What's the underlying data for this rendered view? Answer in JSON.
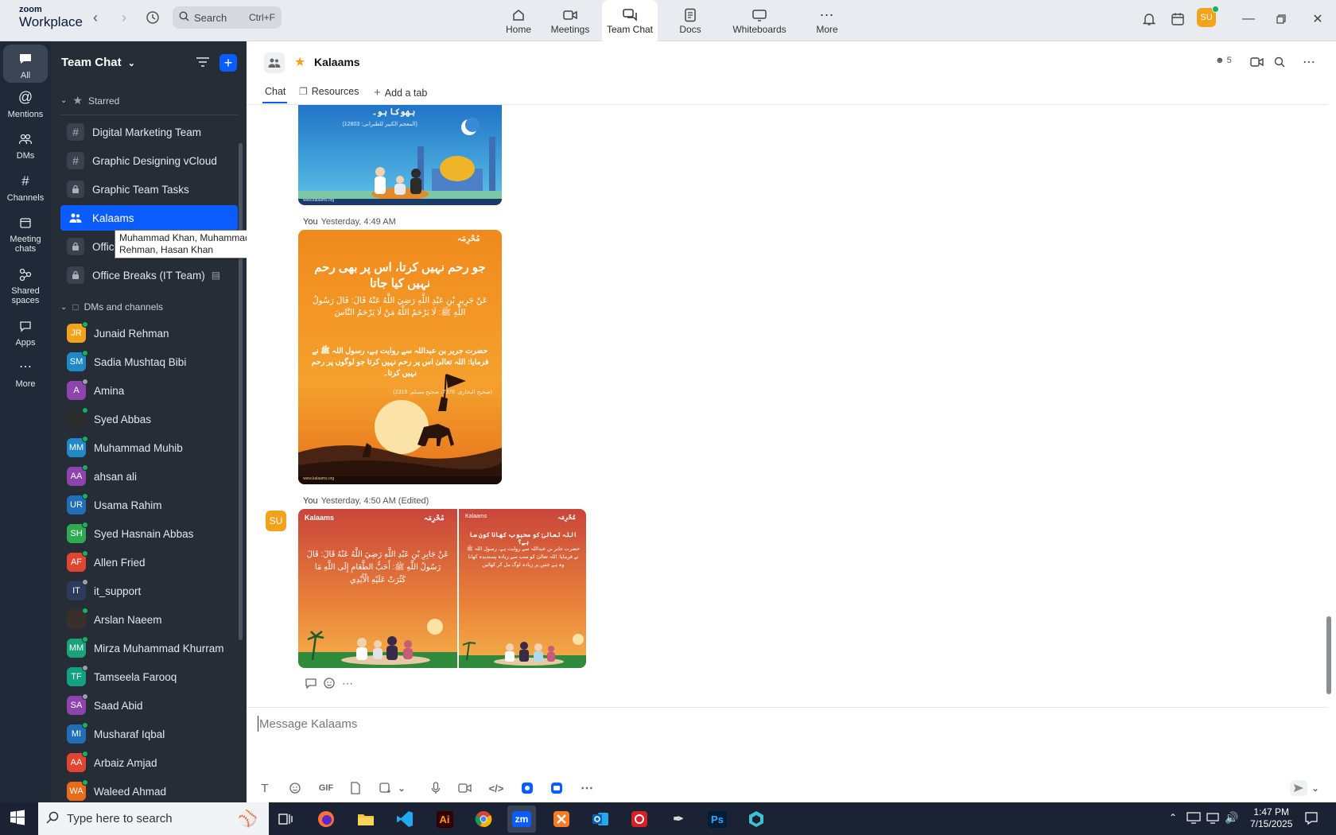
{
  "app": {
    "logo_line1": "zoom",
    "logo_line2": "Workplace"
  },
  "search": {
    "placeholder": "Search",
    "shortcut": "Ctrl+F"
  },
  "top_tabs": [
    {
      "label": "Home",
      "icon": "home-icon"
    },
    {
      "label": "Meetings",
      "icon": "video-camera-icon"
    },
    {
      "label": "Team Chat",
      "icon": "chat-bubbles-icon",
      "active": true
    },
    {
      "label": "Docs",
      "icon": "document-icon"
    },
    {
      "label": "Whiteboards",
      "icon": "whiteboard-icon"
    },
    {
      "label": "More",
      "icon": "more-icon"
    }
  ],
  "user": {
    "initials": "SU",
    "status": "online"
  },
  "rail": [
    {
      "label": "All",
      "icon": "chat-icon",
      "active": true
    },
    {
      "label": "Mentions",
      "icon": "at-icon"
    },
    {
      "label": "DMs",
      "icon": "people-icon"
    },
    {
      "label": "Channels",
      "icon": "hash-icon"
    },
    {
      "label": "Meeting chats",
      "icon": "calendar-icon"
    },
    {
      "label": "Shared spaces",
      "icon": "shared-spaces-icon"
    },
    {
      "label": "Apps",
      "icon": "apps-icon"
    },
    {
      "label": "More",
      "icon": "more-icon"
    }
  ],
  "sidebar": {
    "title": "Team Chat",
    "starred_label": "Starred",
    "starred": [
      {
        "name": "Digital Marketing Team",
        "icon": "hash-icon"
      },
      {
        "name": "Graphic Designing vCloud",
        "icon": "hash-icon"
      },
      {
        "name": "Graphic Team Tasks",
        "icon": "lock-icon"
      },
      {
        "name": "Kalaams",
        "icon": "people-icon",
        "active": true
      },
      {
        "name": "Offic",
        "icon": "lock-icon"
      },
      {
        "name": "Office Breaks (IT Team)",
        "icon": "lock-icon"
      }
    ],
    "dms_label": "DMs and channels",
    "dms": [
      {
        "name": "Junaid Rehman",
        "initials": "JR",
        "color": "#f2a21b",
        "status": "#12b35a"
      },
      {
        "name": "Sadia Mushtaq Bibi",
        "initials": "SM",
        "color": "#1e88c8",
        "status": "#12b35a"
      },
      {
        "name": "Amina",
        "initials": "A",
        "color": "#8e44ad",
        "status": "#9aa0a6"
      },
      {
        "name": "Syed Abbas",
        "initials": "",
        "color": "#2b2b2b",
        "status": "#12b35a"
      },
      {
        "name": "Muhammad Muhib",
        "initials": "MM",
        "color": "#1e88c8",
        "status": "#12b35a"
      },
      {
        "name": "ahsan ali",
        "initials": "AA",
        "color": "#8e44ad",
        "status": "#12b35a"
      },
      {
        "name": "Usama Rahim",
        "initials": "UR",
        "color": "#1e6fb8",
        "status": "#12b35a"
      },
      {
        "name": "Syed Hasnain Abbas",
        "initials": "SH",
        "color": "#2eaa52",
        "status": "#12b35a"
      },
      {
        "name": "Allen Fried",
        "initials": "AF",
        "color": "#e0452f",
        "status": "#12b35a"
      },
      {
        "name": "it_support",
        "initials": "IT",
        "color": "#2d3a5c",
        "status": "#9aa0a6"
      },
      {
        "name": "Arslan Naeem",
        "initials": "",
        "color": "#3a2f2a",
        "status": "#12b35a"
      },
      {
        "name": "Mirza Muhammad Khurram",
        "initials": "MM",
        "color": "#1aa37a",
        "status": "#12b35a"
      },
      {
        "name": "Tamseela Farooq",
        "initials": "TF",
        "color": "#14a085",
        "status": "#9aa0a6"
      },
      {
        "name": "Saad Abid",
        "initials": "SA",
        "color": "#8e44ad",
        "status": "#9aa0a6"
      },
      {
        "name": "Musharaf Iqbal",
        "initials": "MI",
        "color": "#1e6fb8",
        "status": "#12b35a"
      },
      {
        "name": "Arbaiz Amjad",
        "initials": "AA",
        "color": "#e0452f",
        "status": "#12b35a"
      },
      {
        "name": "Waleed Ahmad",
        "initials": "WA",
        "color": "#e86a1a",
        "status": "#12b35a"
      }
    ],
    "tooltip": "Muhammad Khan, Muhammad Muhib, Junaid Rehman, Hasan Khan"
  },
  "channel": {
    "title": "Kalaams",
    "member_count": "5",
    "tabs": [
      {
        "label": "Chat",
        "active": true
      },
      {
        "label": "Resources"
      },
      {
        "label": "Add a tab"
      }
    ]
  },
  "messages": [
    {
      "sender": "You",
      "time": "Yesterday, 4:49 AM"
    },
    {
      "sender": "You",
      "time": "Yesterday, 4:50 AM (Edited)",
      "avatar": "SU"
    }
  ],
  "images": {
    "img1": {
      "line1": "بھوکا ہو۔",
      "line2": "(المعجم الکبیر للطبرانی: 12803)",
      "footer": "www.kalaams.org"
    },
    "img2": {
      "badge": "مُحْرِمَہ",
      "urdu_title": "جو رحم نہیں کرتا، اس پر بھی رحم نہیں کیا جاتا",
      "arabic": "عَنْ جَرِيرِ بْنِ عَبْدِ اللَّهِ رَضِيَ اللَّهُ عَنْهُ قَالَ: قَالَ رَسُولُ اللَّهِ ﷺ: لَا يَرْحَمُ اللَّهُ مَنْ لَا يَرْحَمُ النَّاسَ",
      "urdu_body": "حضرت جریر بن عبداللہ سے روایت ہے، رسول اللہ ﷺ نے فرمایا: اللہ تعالیٰ اس پر رحم نہیں کرتا جو لوگوں پر رحم نہیں کرتا۔",
      "reference": "(صحیح البخاری: 7376، صحیح مسلم: 2319)",
      "footer": "www.kalaams.org"
    },
    "img3": {
      "brand": "Kalaams",
      "badge": "مُحْرِمَہ",
      "arabic": "عَنْ جَابِرِ بْنِ عَبْدِ اللَّهِ رَضِيَ اللَّهُ عَنْهُ قَالَ: قَالَ رَسُولُ اللَّهِ ﷺ: أَحَبُّ الطَّعَامِ إِلَى اللَّهِ مَا كَثُرَتْ عَلَيْهِ الْأَيْدِي",
      "urdu_title": "اللہ تعالیٰ کو محبوب کھانا کون سا ہے؟",
      "urdu_body": "حضرت جابر بن عبداللہ سے روایت ہے، رسول اللہ ﷺ نے فرمایا: اللہ تعالیٰ کو سب سے زیادہ پسندیدہ کھانا وہ ہے جس پر زیادہ لوگ مل کر کھائیں"
    }
  },
  "composer": {
    "placeholder": "Message Kalaams"
  },
  "taskbar": {
    "search_placeholder": "Type here to search",
    "apps": [
      "task-view",
      "firefox",
      "file-explorer",
      "vscode",
      "illustrator",
      "chrome",
      "zoom",
      "xampp",
      "outlook",
      "creative-cloud",
      "pen-tool",
      "photoshop",
      "app"
    ],
    "time": "1:47 PM",
    "date": "7/15/2025",
    "status_labels": [
      "Ai",
      "zm",
      "Ps"
    ]
  }
}
